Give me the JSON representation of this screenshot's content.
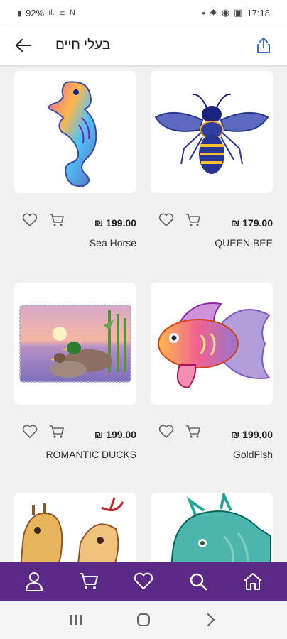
{
  "status_bar": {
    "battery": "92%",
    "time": "17:18"
  },
  "header": {
    "title": "בעלי חיים",
    "back_icon": "arrow-left-icon",
    "share_icon": "share-icon"
  },
  "products": [
    {
      "name": "Sea Horse",
      "price": "₪ 199.00",
      "image": "seahorse"
    },
    {
      "name": "QUEEN BEE",
      "price": "₪ 179.00",
      "image": "bee"
    },
    {
      "name": "ROMANTIC DUCKS",
      "price": "₪ 199.00",
      "image": "ducks"
    },
    {
      "name": "GoldFish",
      "price": "₪ 199.00",
      "image": "goldfish"
    },
    {
      "name": "",
      "price": "",
      "image": "giraffes"
    },
    {
      "name": "",
      "price": "",
      "image": "dragon"
    }
  ],
  "bottom_nav": {
    "items": [
      "user-icon",
      "cart-icon",
      "heart-icon",
      "search-icon",
      "home-icon"
    ],
    "color": "#5b2a86"
  },
  "system_nav": {
    "items": [
      "recents-icon",
      "home-circle-icon",
      "back-chevron-icon"
    ]
  }
}
